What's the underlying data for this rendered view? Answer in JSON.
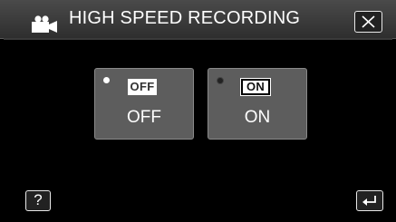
{
  "header": {
    "title": "HIGH SPEED RECORDING",
    "mode_icon": "video-camera-icon",
    "close_icon": "close-icon"
  },
  "options": [
    {
      "icon_text": "OFF",
      "label": "OFF",
      "selected": false
    },
    {
      "icon_text": "ON",
      "label": "ON",
      "selected": true
    }
  ],
  "footer": {
    "help_label": "?",
    "help_icon": "help-icon",
    "back_icon": "return-icon"
  },
  "colors": {
    "background": "#000000",
    "header": "#3a3a3a",
    "option_button": "#5d5d5d",
    "text": "#ffffff"
  }
}
